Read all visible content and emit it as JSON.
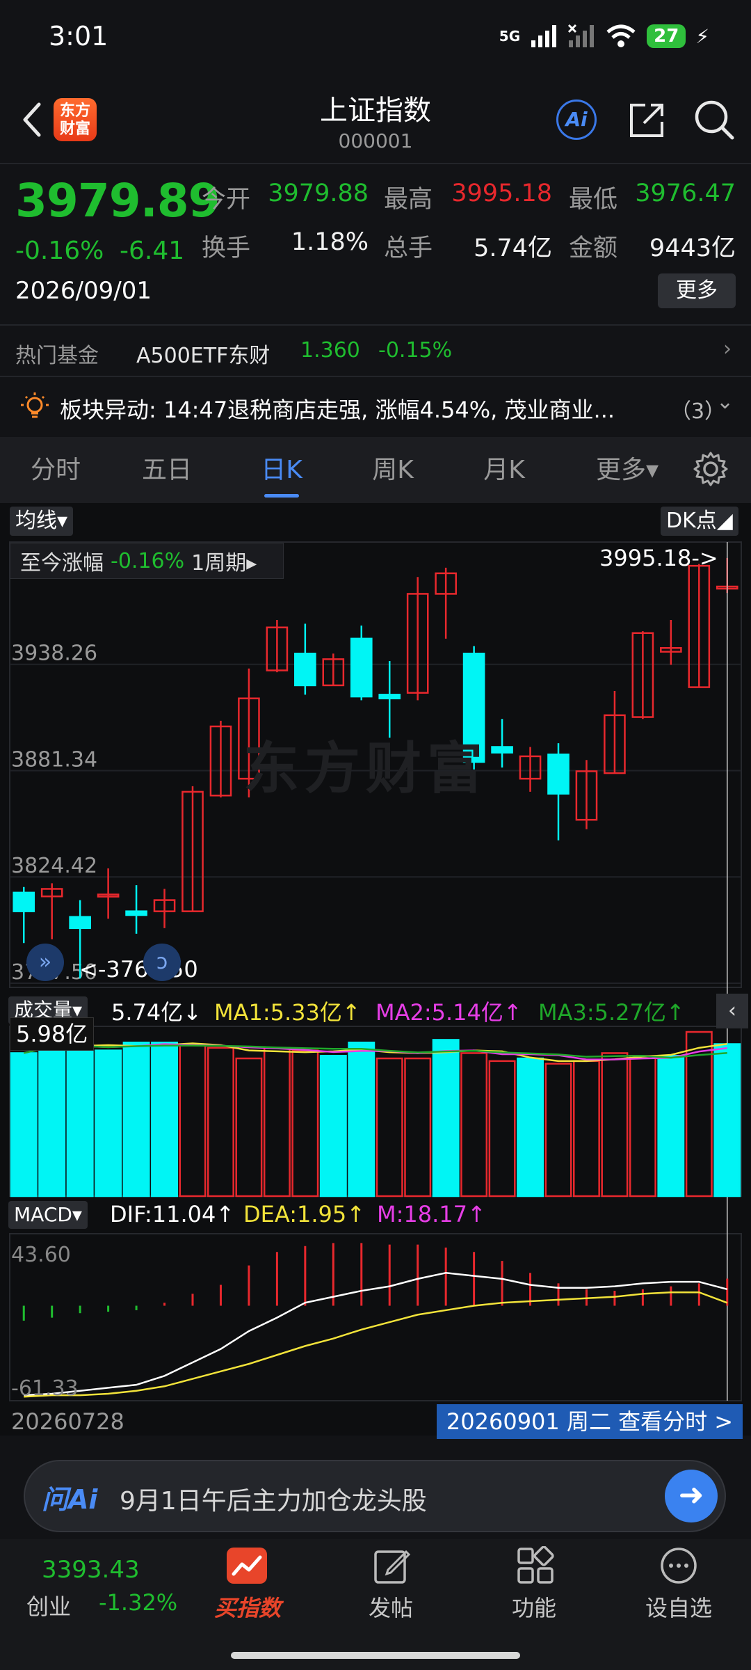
{
  "status_bar": {
    "time": "3:01",
    "network": "5G",
    "battery": "27"
  },
  "header": {
    "title": "上证指数",
    "code": "000001",
    "logo_text": "东方财富",
    "ai_label": "Ai"
  },
  "quote": {
    "price": "3979.89",
    "change_pct": "-0.16%",
    "change": "-6.41",
    "date": "2026/09/01",
    "fields": [
      {
        "label": "今开",
        "value": "3979.88",
        "color": "#1fbd2f"
      },
      {
        "label": "最高",
        "value": "3995.18",
        "color": "#e8282d"
      },
      {
        "label": "最低",
        "value": "3976.47",
        "color": "#1fbd2f"
      },
      {
        "label": "换手",
        "value": "1.18%",
        "color": "#f2f2f2"
      },
      {
        "label": "总手",
        "value": "5.74亿",
        "color": "#f2f2f2"
      },
      {
        "label": "金额",
        "value": "9443亿",
        "color": "#f2f2f2"
      }
    ],
    "more_label": "更多"
  },
  "hot_fund": {
    "label": "热门基金",
    "name": "A500ETF东财",
    "price": "1.360",
    "change_pct": "-0.15%"
  },
  "news": {
    "text": "板块异动: 14:47退税商店走强, 涨幅4.54%, 茂业商业...",
    "count": "（3）"
  },
  "tabs": [
    {
      "label": "分时",
      "active": false
    },
    {
      "label": "五日",
      "active": false
    },
    {
      "label": "日K",
      "active": true
    },
    {
      "label": "周K",
      "active": false
    },
    {
      "label": "月K",
      "active": false
    },
    {
      "label": "更多▾",
      "active": false
    }
  ],
  "chart": {
    "ma_selector": "均线▾",
    "dk_label": "DK点◢",
    "period_info": {
      "label": "至今涨幅",
      "value": "-0.16%",
      "period": "1周期▸"
    },
    "watermark": "东方财富",
    "high_label": "3995.18->",
    "low_label": "<-3767.50",
    "volume": {
      "selector": "成交量▾",
      "current": "5.74亿↓",
      "ma1": "MA1:5.33亿↑",
      "ma2": "MA2:5.14亿↑",
      "ma3": "MA3:5.27亿↑",
      "scale_label": "5.98亿"
    },
    "macd": {
      "selector": "MACD▾",
      "dif": "DIF:11.04↑",
      "dea": "DEA:1.95↑",
      "m": "M:18.17↑",
      "ymax": "43.60",
      "ymin": "-61.33"
    },
    "start_date": "20260728",
    "end_date_banner": "20260901 周二 查看分时 >"
  },
  "chart_data": [
    {
      "type": "candlestick",
      "y_ticks": [
        "3938.26",
        "3881.34",
        "3824.42",
        "3767.50"
      ],
      "ylim": [
        3767.5,
        4000
      ],
      "candles": [
        {
          "o": 3816,
          "c": 3806,
          "h": 3819,
          "l": 3789
        },
        {
          "o": 3814,
          "c": 3818,
          "h": 3821,
          "l": 3791
        },
        {
          "o": 3803,
          "c": 3797,
          "h": 3812,
          "l": 3770
        },
        {
          "o": 3815,
          "c": 3815,
          "h": 3829,
          "l": 3802
        },
        {
          "o": 3806,
          "c": 3804,
          "h": 3820,
          "l": 3794
        },
        {
          "o": 3806,
          "c": 3812,
          "h": 3818,
          "l": 3797
        },
        {
          "o": 3806,
          "c": 3870,
          "h": 3873,
          "l": 3806
        },
        {
          "o": 3868,
          "c": 3905,
          "h": 3908,
          "l": 3867
        },
        {
          "o": 3877,
          "c": 3920,
          "h": 3936,
          "l": 3867
        },
        {
          "o": 3935,
          "c": 3958,
          "h": 3962,
          "l": 3934
        },
        {
          "o": 3944,
          "c": 3927,
          "h": 3960,
          "l": 3922
        },
        {
          "o": 3927,
          "c": 3941,
          "h": 3944,
          "l": 3927
        },
        {
          "o": 3952,
          "c": 3921,
          "h": 3959,
          "l": 3919
        },
        {
          "o": 3922,
          "c": 3920,
          "h": 3940,
          "l": 3899
        },
        {
          "o": 3923,
          "c": 3976,
          "h": 3985,
          "l": 3919
        },
        {
          "o": 3976,
          "c": 3987,
          "h": 3990,
          "l": 3952
        },
        {
          "o": 3944,
          "c": 3886,
          "h": 3948,
          "l": 3882
        },
        {
          "o": 3894,
          "c": 3891,
          "h": 3909,
          "l": 3883
        },
        {
          "o": 3877,
          "c": 3889,
          "h": 3894,
          "l": 3870
        },
        {
          "o": 3890,
          "c": 3869,
          "h": 3896,
          "l": 3844
        },
        {
          "o": 3855,
          "c": 3881,
          "h": 3887,
          "l": 3850
        },
        {
          "o": 3880,
          "c": 3911,
          "h": 3924,
          "l": 3880
        },
        {
          "o": 3910,
          "c": 3955,
          "h": 3956,
          "l": 3909
        },
        {
          "o": 3945,
          "c": 3947,
          "h": 3962,
          "l": 3938
        },
        {
          "o": 3926,
          "c": 3991,
          "h": 3992,
          "l": 3926
        },
        {
          "o": 3979.88,
          "c": 3979.89,
          "h": 3995.18,
          "l": 3976.47
        }
      ]
    },
    {
      "type": "bar",
      "series_label": "成交量(亿)",
      "values": [
        5.4,
        5.9,
        5.7,
        5.5,
        5.8,
        5.8,
        5.7,
        5.6,
        5.2,
        5.6,
        5.5,
        5.3,
        5.8,
        5.2,
        5.2,
        5.9,
        5.4,
        5.1,
        5.2,
        5.0,
        5.1,
        5.4,
        5.3,
        5.3,
        6.2,
        5.74
      ],
      "up": [
        false,
        false,
        false,
        false,
        false,
        false,
        true,
        true,
        true,
        true,
        true,
        false,
        false,
        true,
        true,
        false,
        true,
        true,
        false,
        true,
        true,
        true,
        true,
        false,
        true,
        false
      ],
      "ylim": [
        0,
        6.2
      ]
    },
    {
      "type": "line",
      "series": [
        {
          "name": "DIF",
          "color": "#ffffff",
          "values": [
            -60,
            -59,
            -57,
            -55,
            -53,
            -47,
            -38,
            -29,
            -17,
            -8,
            2,
            6,
            10,
            13,
            18,
            22,
            20,
            18,
            14,
            12,
            12,
            13,
            15,
            16,
            16,
            11.04
          ]
        },
        {
          "name": "DEA",
          "color": "#f2e33a",
          "values": [
            -61,
            -60,
            -60,
            -59,
            -57,
            -54,
            -49,
            -44,
            -39,
            -33,
            -27,
            -22,
            -16,
            -11,
            -6,
            -3,
            0,
            2,
            3,
            4,
            5,
            6,
            8,
            9,
            9,
            1.95
          ]
        }
      ],
      "bars": [
        -10,
        -8,
        -5,
        -4,
        -3,
        2,
        8,
        14,
        27,
        36,
        40,
        42,
        42,
        41,
        41,
        39,
        36,
        30,
        22,
        15,
        11,
        10,
        11,
        13,
        15,
        18.17
      ],
      "ylim": [
        -61.33,
        43.6
      ]
    }
  ],
  "ai_bar": {
    "logo": "问Ai",
    "query": "9月1日午后主力加仓龙头股"
  },
  "bottom_nav": {
    "index_price": "3393.43",
    "index_name": "创业",
    "index_pct": "-1.32%",
    "items": [
      {
        "label": "买指数",
        "active": true
      },
      {
        "label": "发帖",
        "active": false
      },
      {
        "label": "功能",
        "active": false
      },
      {
        "label": "设自选",
        "active": false
      }
    ]
  }
}
